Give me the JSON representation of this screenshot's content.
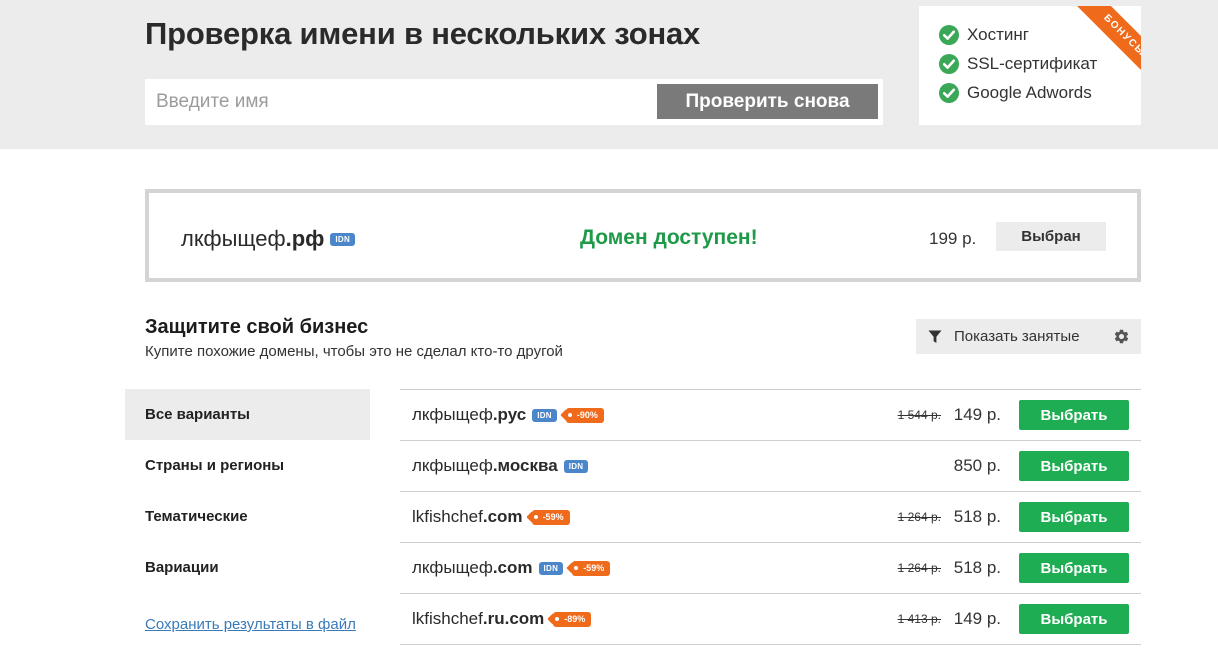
{
  "header": {
    "title": "Проверка имени в нескольких зонах",
    "search_placeholder": "Введите имя",
    "check_button": "Проверить снова"
  },
  "bonus": {
    "ribbon": "БОНУСЫ",
    "items": [
      "Хостинг",
      "SSL-сертификат",
      "Google Adwords"
    ]
  },
  "result": {
    "name": "лкфыщеф",
    "tld": ".рф",
    "badge": "IDN",
    "status": "Домен доступен!",
    "price": "199 р.",
    "button": "Выбран"
  },
  "section": {
    "title": "Защитите свой бизнес",
    "subtitle": "Купите похожие домены, чтобы это не сделал кто-то другой",
    "filter_label": "Показать занятые"
  },
  "sidebar": {
    "items": [
      "Все варианты",
      "Страны и регионы",
      "Тематические",
      "Вариации"
    ],
    "save_link": "Сохранить результаты в файл"
  },
  "domains": [
    {
      "name": "лкфыщеф",
      "tld": ".рус",
      "idn": "IDN",
      "discount": "-90%",
      "old_price": "1 544 р.",
      "price": "149 р.",
      "button": "Выбрать"
    },
    {
      "name": "лкфыщеф",
      "tld": ".москва",
      "idn": "IDN",
      "discount": "",
      "old_price": "",
      "price": "850 р.",
      "button": "Выбрать"
    },
    {
      "name": "lkfishchef",
      "tld": ".com",
      "idn": "",
      "discount": "-59%",
      "old_price": "1 264 р.",
      "price": "518 р.",
      "button": "Выбрать"
    },
    {
      "name": "лкфыщеф",
      "tld": ".com",
      "idn": "IDN",
      "discount": "-59%",
      "old_price": "1 264 р.",
      "price": "518 р.",
      "button": "Выбрать"
    },
    {
      "name": "lkfishchef",
      "tld": ".ru.com",
      "idn": "",
      "discount": "-89%",
      "old_price": "1 413 р.",
      "price": "149 р.",
      "button": "Выбрать"
    }
  ],
  "colors": {
    "accent_green": "#1fad53",
    "status_green": "#1e9a49",
    "discount_orange": "#f06a1b",
    "idn_blue": "#4a86c9"
  },
  "icons": {
    "bonus_check": "check-circle-icon",
    "filter": "funnel-icon",
    "settings": "gear-icon"
  }
}
